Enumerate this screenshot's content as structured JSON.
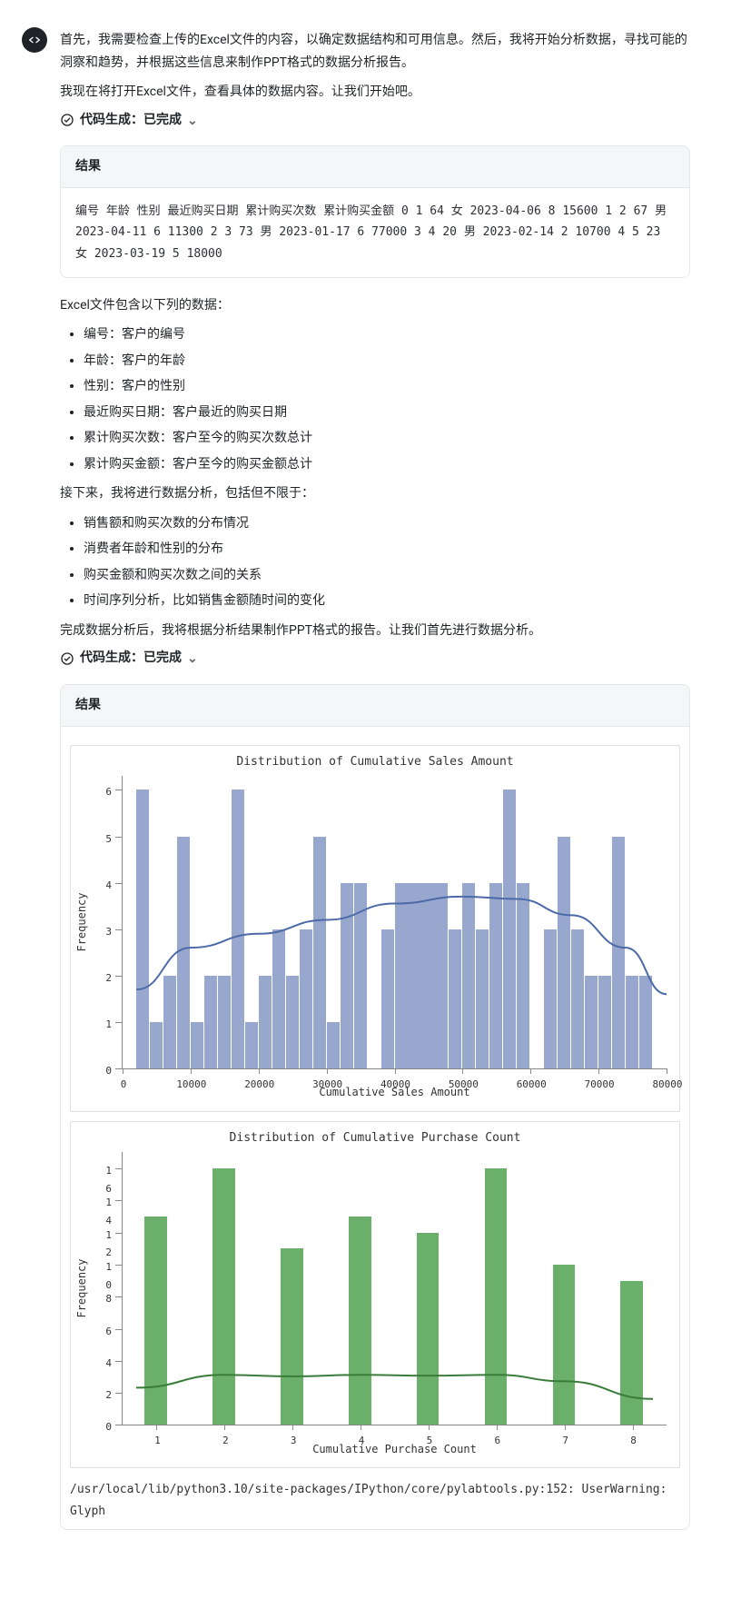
{
  "avatar_icon": "code-icon",
  "intro_p1": "首先，我需要检查上传的Excel文件的内容，以确定数据结构和可用信息。然后，我将开始分析数据，寻找可能的洞察和趋势，并根据这些信息来制作PPT格式的数据分析报告。",
  "intro_p2": "我现在将打开Excel文件，查看具体的数据内容。让我们开始吧。",
  "status1_prefix": "代码生成：",
  "status1_state": "已完成",
  "result_label": "结果",
  "result1_text": "编号 年龄 性别 最近购买日期 累计购买次数 累计购买金额 0 1 64 女 2023-04-06 8 15600 1 2 67 男 2023-04-11 6 11300 2 3 73 男 2023-01-17 6 77000 3 4 20 男 2023-02-14 2 10700 4 5 23 女 2023-03-19 5 18000",
  "cols_intro": "Excel文件包含以下列的数据：",
  "cols": [
    "编号：客户的编号",
    "年龄：客户的年龄",
    "性别：客户的性别",
    "最近购买日期：客户最近的购买日期",
    "累计购买次数：客户至今的购买次数总计",
    "累计购买金额：客户至今的购买金额总计"
  ],
  "analysis_intro": "接下来，我将进行数据分析，包括但不限于：",
  "analysis": [
    "销售额和购买次数的分布情况",
    "消费者年龄和性别的分布",
    "购买金额和购买次数之间的关系",
    "时间序列分析，比如销售金额随时间的变化"
  ],
  "after_p": "完成数据分析后，我将根据分析结果制作PPT格式的报告。让我们首先进行数据分析。",
  "status2_prefix": "代码生成：",
  "status2_state": "已完成",
  "warning_text": "/usr/local/lib/python3.10/site-packages/IPython/core/pylabtools.py:152: UserWarning: Glyph",
  "chart_data": [
    {
      "type": "bar",
      "title": "Distribution of Cumulative Sales Amount",
      "xlabel": "Cumulative Sales Amount",
      "ylabel": "Frequency",
      "xlim": [
        0,
        80000
      ],
      "ylim": [
        0,
        6.3
      ],
      "xticks": [
        0,
        10000,
        20000,
        30000,
        40000,
        50000,
        60000,
        70000,
        80000
      ],
      "yticks": [
        0,
        1,
        2,
        3,
        4,
        5,
        6
      ],
      "bin_width": 2000,
      "bars": [
        {
          "x": 2000,
          "y": 0
        },
        {
          "x": 4000,
          "y": 6
        },
        {
          "x": 6000,
          "y": 1
        },
        {
          "x": 8000,
          "y": 2
        },
        {
          "x": 10000,
          "y": 5
        },
        {
          "x": 12000,
          "y": 1
        },
        {
          "x": 14000,
          "y": 2
        },
        {
          "x": 16000,
          "y": 2
        },
        {
          "x": 18000,
          "y": 6
        },
        {
          "x": 20000,
          "y": 1
        },
        {
          "x": 22000,
          "y": 2
        },
        {
          "x": 24000,
          "y": 3
        },
        {
          "x": 26000,
          "y": 2
        },
        {
          "x": 28000,
          "y": 3
        },
        {
          "x": 30000,
          "y": 5
        },
        {
          "x": 32000,
          "y": 1
        },
        {
          "x": 34000,
          "y": 4
        },
        {
          "x": 36000,
          "y": 4
        },
        {
          "x": 38000,
          "y": 0
        },
        {
          "x": 40000,
          "y": 3
        },
        {
          "x": 42000,
          "y": 4
        },
        {
          "x": 44000,
          "y": 4
        },
        {
          "x": 46000,
          "y": 4
        },
        {
          "x": 48000,
          "y": 4
        },
        {
          "x": 50000,
          "y": 3
        },
        {
          "x": 52000,
          "y": 4
        },
        {
          "x": 54000,
          "y": 3
        },
        {
          "x": 56000,
          "y": 4
        },
        {
          "x": 58000,
          "y": 6
        },
        {
          "x": 60000,
          "y": 4
        },
        {
          "x": 62000,
          "y": 0
        },
        {
          "x": 64000,
          "y": 3
        },
        {
          "x": 66000,
          "y": 5
        },
        {
          "x": 68000,
          "y": 3
        },
        {
          "x": 70000,
          "y": 2
        },
        {
          "x": 72000,
          "y": 2
        },
        {
          "x": 74000,
          "y": 5
        },
        {
          "x": 76000,
          "y": 2
        },
        {
          "x": 78000,
          "y": 2
        },
        {
          "x": 80000,
          "y": 0
        }
      ],
      "kde": [
        {
          "x": 2000,
          "y": 1.7
        },
        {
          "x": 10000,
          "y": 2.6
        },
        {
          "x": 20000,
          "y": 2.9
        },
        {
          "x": 30000,
          "y": 3.2
        },
        {
          "x": 40000,
          "y": 3.55
        },
        {
          "x": 50000,
          "y": 3.7
        },
        {
          "x": 58000,
          "y": 3.65
        },
        {
          "x": 66000,
          "y": 3.3
        },
        {
          "x": 74000,
          "y": 2.6
        },
        {
          "x": 80000,
          "y": 1.6
        }
      ],
      "color": "blue"
    },
    {
      "type": "bar",
      "title": "Distribution of Cumulative Purchase Count",
      "xlabel": "Cumulative Purchase Count",
      "ylabel": "Frequency",
      "xlim": [
        0.5,
        8.5
      ],
      "ylim": [
        0,
        17
      ],
      "xticks": [
        1,
        2,
        3,
        4,
        5,
        6,
        7,
        8
      ],
      "yticks": [
        0,
        2,
        4,
        6,
        8,
        10,
        12,
        14,
        16
      ],
      "bin_width": 0.35,
      "bars": [
        {
          "x": 1,
          "y": 13
        },
        {
          "x": 2,
          "y": 16
        },
        {
          "x": 3,
          "y": 11
        },
        {
          "x": 4,
          "y": 13
        },
        {
          "x": 5,
          "y": 12
        },
        {
          "x": 6,
          "y": 16
        },
        {
          "x": 7,
          "y": 10
        },
        {
          "x": 8,
          "y": 9
        }
      ],
      "kde": [
        {
          "x": 0.7,
          "y": 2.3
        },
        {
          "x": 2,
          "y": 3.1
        },
        {
          "x": 3,
          "y": 3.0
        },
        {
          "x": 4,
          "y": 3.1
        },
        {
          "x": 5,
          "y": 3.05
        },
        {
          "x": 6,
          "y": 3.1
        },
        {
          "x": 7,
          "y": 2.7
        },
        {
          "x": 8.3,
          "y": 1.6
        }
      ],
      "color": "green"
    }
  ]
}
